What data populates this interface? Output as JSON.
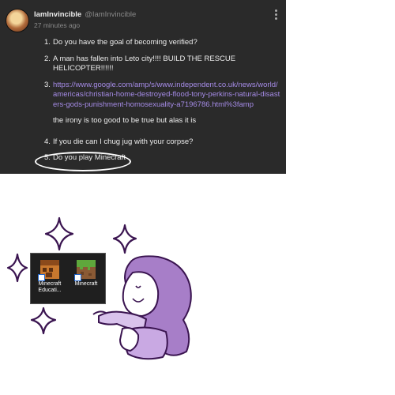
{
  "post": {
    "username": "IamInvincible",
    "handle": "@IamInvincible",
    "timestamp": "27 minutes ago",
    "items": [
      {
        "num": "1.",
        "text": "Do you have the goal of becoming verified?"
      },
      {
        "num": "2.",
        "text": "A man has fallen into Leto city!!!! BUILD THE RESCUE HELICOPTER!!!!!!"
      },
      {
        "num": "3.",
        "link": "https://www.google.com/amp/s/www.independent.co.uk/news/world/americas/christian-home-destroyed-flood-tony-perkins-natural-disasters-gods-punishment-homosexuality-a7196786.html%3famp"
      },
      {
        "num": "4.",
        "text": "If you die can I chug jug with your corpse?"
      },
      {
        "num": "5.",
        "text": "Do you play Minecraft"
      }
    ],
    "note": "the irony is too good to be true but alas it is"
  },
  "desktop": {
    "icons": [
      {
        "label": "Minecraft Educati...",
        "icon": "minecraft-education-icon"
      },
      {
        "label": "Minecraft",
        "icon": "minecraft-grass-block-icon"
      }
    ]
  },
  "colors": {
    "post_bg": "#2a2a2a",
    "text": "#ececec",
    "muted": "#8a8a8a",
    "link": "#a58be6",
    "character_purple": "#a77ec8",
    "sparkle": "#3a1450"
  }
}
